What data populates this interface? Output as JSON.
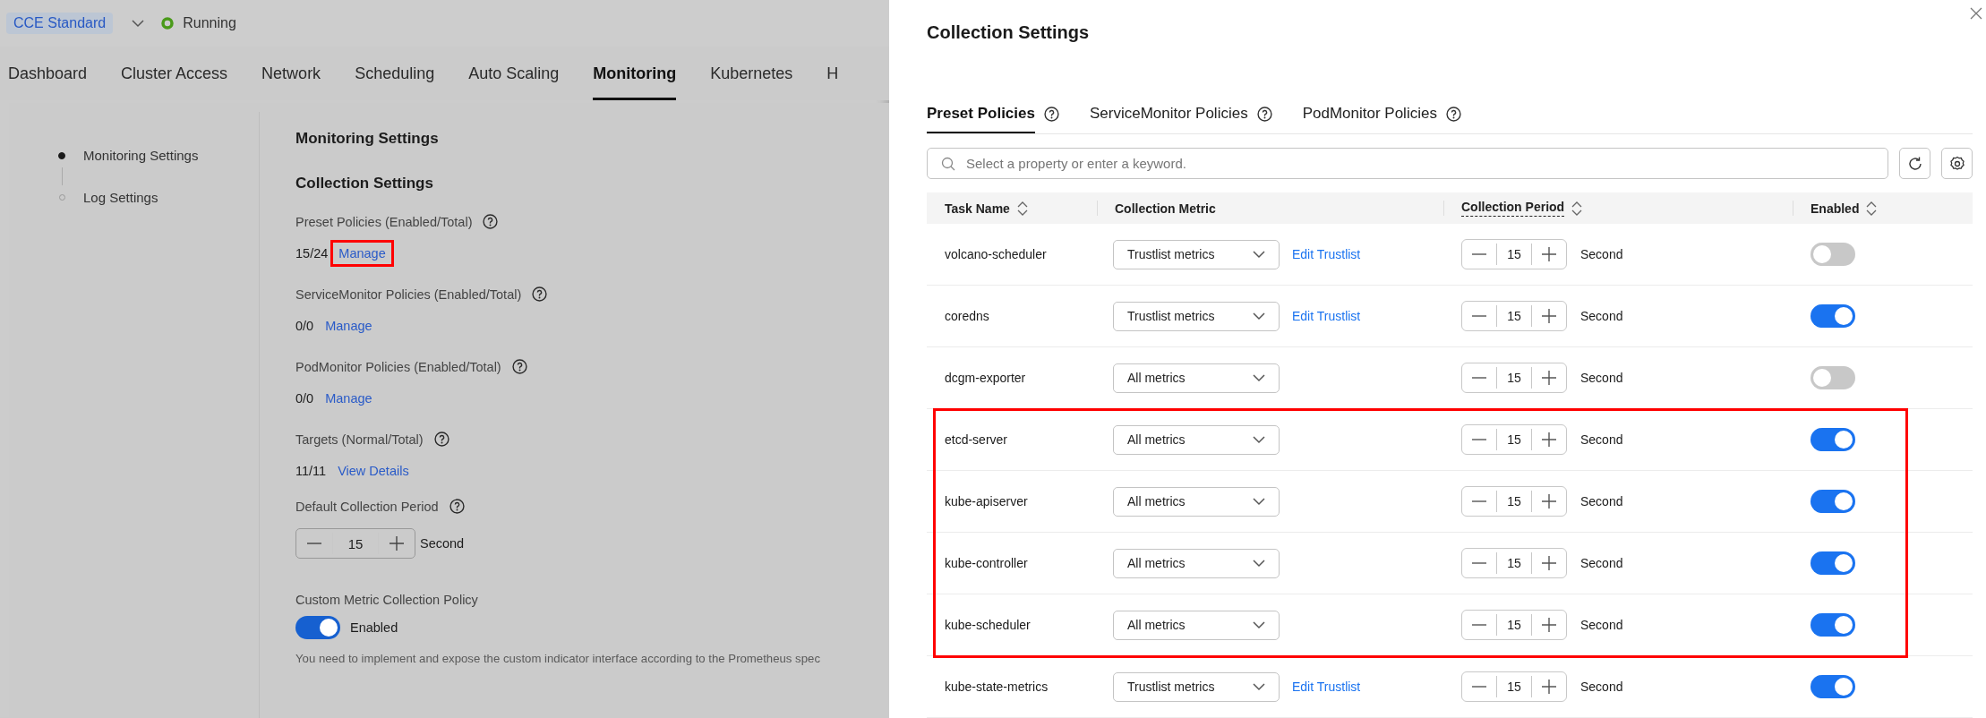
{
  "header": {
    "edition": "CCE Standard",
    "status": "Running"
  },
  "nav_tabs": [
    {
      "label": "Dashboard",
      "selected": false
    },
    {
      "label": "Cluster Access",
      "selected": false
    },
    {
      "label": "Network",
      "selected": false
    },
    {
      "label": "Scheduling",
      "selected": false
    },
    {
      "label": "Auto Scaling",
      "selected": false
    },
    {
      "label": "Monitoring",
      "selected": true
    },
    {
      "label": "Kubernetes",
      "selected": false
    },
    {
      "label": "H",
      "selected": false
    }
  ],
  "settings_nav": [
    {
      "label": "Monitoring Settings",
      "selected": true
    },
    {
      "label": "Log Settings",
      "selected": false
    }
  ],
  "monitoring": {
    "title": "Monitoring Settings",
    "subtitle": "Collection Settings",
    "stats": [
      {
        "label": "Preset Policies (Enabled/Total)",
        "value": "15/24",
        "link": "Manage",
        "highlighted": true
      },
      {
        "label": "ServiceMonitor Policies (Enabled/Total)",
        "value": "0/0",
        "link": "Manage",
        "highlighted": false
      },
      {
        "label": "PodMonitor Policies (Enabled/Total)",
        "value": "0/0",
        "link": "Manage",
        "highlighted": false
      },
      {
        "label": "Targets (Normal/Total)",
        "value": "11/11",
        "link": "View Details",
        "highlighted": false
      }
    ],
    "default_period": {
      "label": "Default Collection Period",
      "value": "15",
      "unit": "Second"
    },
    "custom_policy": {
      "label": "Custom Metric Collection Policy",
      "on": true,
      "state_label": "Enabled",
      "note": "You need to implement and expose the custom indicator interface according to the Prometheus spec"
    }
  },
  "drawer": {
    "title": "Collection Settings",
    "tabs": [
      {
        "label": "Preset Policies",
        "selected": true
      },
      {
        "label": "ServiceMonitor Policies",
        "selected": false
      },
      {
        "label": "PodMonitor Policies",
        "selected": false
      }
    ],
    "search": {
      "placeholder": "Select a property or enter a keyword."
    },
    "table": {
      "columns": [
        {
          "label": "Task Name",
          "sortable": true,
          "dotted": false
        },
        {
          "label": "Collection Metric",
          "sortable": false,
          "dotted": false
        },
        {
          "label": "Collection Period",
          "sortable": true,
          "dotted": true
        },
        {
          "label": "Enabled",
          "sortable": true,
          "dotted": false
        }
      ],
      "rows": [
        {
          "task": "volcano-scheduler",
          "metric": "Trustlist metrics",
          "edit_link": "Edit Trustlist",
          "period": "15",
          "unit": "Second",
          "enabled": false,
          "highlighted": false
        },
        {
          "task": "coredns",
          "metric": "Trustlist metrics",
          "edit_link": "Edit Trustlist",
          "period": "15",
          "unit": "Second",
          "enabled": true,
          "highlighted": false
        },
        {
          "task": "dcgm-exporter",
          "metric": "All metrics",
          "period": "15",
          "unit": "Second",
          "enabled": false,
          "highlighted": false
        },
        {
          "task": "etcd-server",
          "metric": "All metrics",
          "period": "15",
          "unit": "Second",
          "enabled": true,
          "highlighted": true
        },
        {
          "task": "kube-apiserver",
          "metric": "All metrics",
          "period": "15",
          "unit": "Second",
          "enabled": true,
          "highlighted": true
        },
        {
          "task": "kube-controller",
          "metric": "All metrics",
          "period": "15",
          "unit": "Second",
          "enabled": true,
          "highlighted": true
        },
        {
          "task": "kube-scheduler",
          "metric": "All metrics",
          "period": "15",
          "unit": "Second",
          "enabled": true,
          "highlighted": true
        },
        {
          "task": "kube-state-metrics",
          "metric": "Trustlist metrics",
          "edit_link": "Edit Trustlist",
          "period": "15",
          "unit": "Second",
          "enabled": true,
          "highlighted": false
        }
      ]
    }
  }
}
